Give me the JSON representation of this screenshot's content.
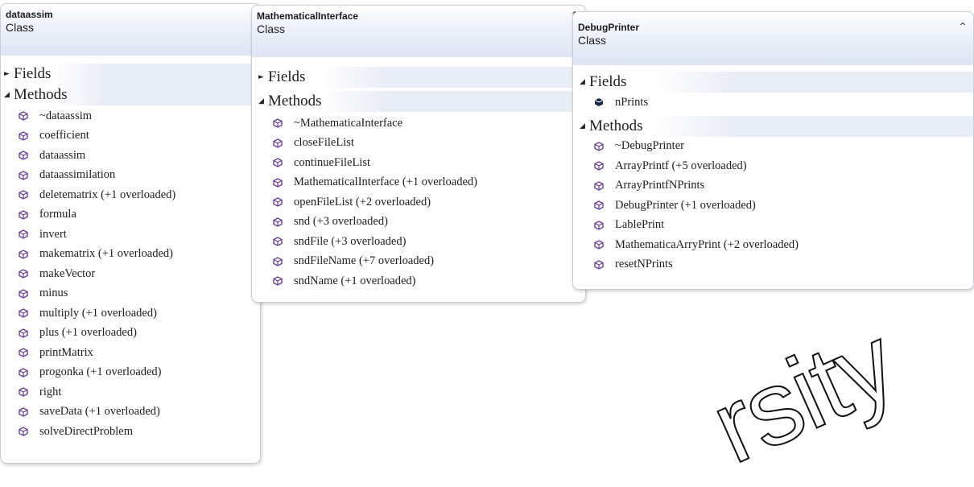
{
  "classes": [
    {
      "name": "dataassim",
      "kind": "Class",
      "fields_label": "Fields",
      "methods_label": "Methods",
      "fields": [],
      "methods": [
        "~dataassim",
        "coefficient",
        "dataassim",
        "dataassimilation",
        "deletematrix (+1 overloaded)",
        "formula",
        "invert",
        "makematrix (+1 overloaded)",
        "makeVector",
        "minus",
        "multiply (+1 overloaded)",
        "plus (+1 overloaded)",
        "printMatrix",
        "progonka (+1 overloaded)",
        "right",
        "saveData (+1 overloaded)",
        "solveDirectProblem"
      ]
    },
    {
      "name": "MathematicalInterface",
      "kind": "Class",
      "fields_label": "Fields",
      "methods_label": "Methods",
      "fields": [],
      "methods": [
        "~MathematicaInterface",
        "closeFileList",
        "continueFileList",
        "MathematicalInterface (+1 overloaded)",
        "openFileList (+2 overloaded)",
        "snd (+3 overloaded)",
        "sndFile (+3 overloaded)",
        "sndFileName (+7 overloaded)",
        "sndName (+1 overloaded)"
      ]
    },
    {
      "name": "DebugPrinter",
      "kind": "Class",
      "fields_label": "Fields",
      "methods_label": "Methods",
      "fields": [
        "nPrints"
      ],
      "methods": [
        "~DebugPrinter",
        "ArrayPrintf (+5 overloaded)",
        "ArrayPrintfNPrints",
        "DebugPrinter (+1 overloaded)",
        "LablePrint",
        "MathematicaArryPrint (+2 overloaded)",
        "resetNPrints"
      ]
    }
  ],
  "icons": {
    "method": "method-cube-icon",
    "field": "field-icon",
    "collapse": "double-chevron-up-icon"
  },
  "colors": {
    "method_icon": "#6b3fa0",
    "field_icon": "#1a2a4a",
    "header_gradient_end": "#dde5f3"
  },
  "watermark": "rsity"
}
